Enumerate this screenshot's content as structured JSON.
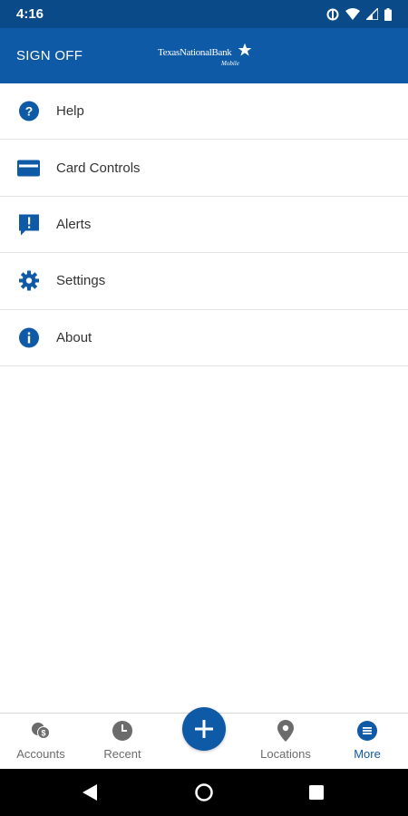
{
  "status_bar": {
    "time": "4:16"
  },
  "header": {
    "sign_off_label": "SIGN OFF",
    "logo_text": "TexasNationalBank",
    "logo_subtext": "Mobile"
  },
  "menu": {
    "items": [
      {
        "label": "Help",
        "icon": "help-icon"
      },
      {
        "label": "Card Controls",
        "icon": "card-icon"
      },
      {
        "label": "Alerts",
        "icon": "alert-icon"
      },
      {
        "label": "Settings",
        "icon": "gear-icon"
      },
      {
        "label": "About",
        "icon": "info-icon"
      }
    ]
  },
  "bottom_nav": {
    "tabs": [
      {
        "label": "Accounts",
        "icon": "accounts-icon"
      },
      {
        "label": "Recent",
        "icon": "clock-icon"
      },
      {
        "label": "Locations",
        "icon": "location-pin-icon"
      },
      {
        "label": "More",
        "icon": "menu-icon"
      }
    ],
    "active_tab": "More",
    "fab_icon": "plus-icon"
  },
  "colors": {
    "primary": "#0e5aa6",
    "status_bar": "#0b4a88",
    "active_tab": "#0e5aa6",
    "inactive_tab": "#6b6b6b"
  }
}
